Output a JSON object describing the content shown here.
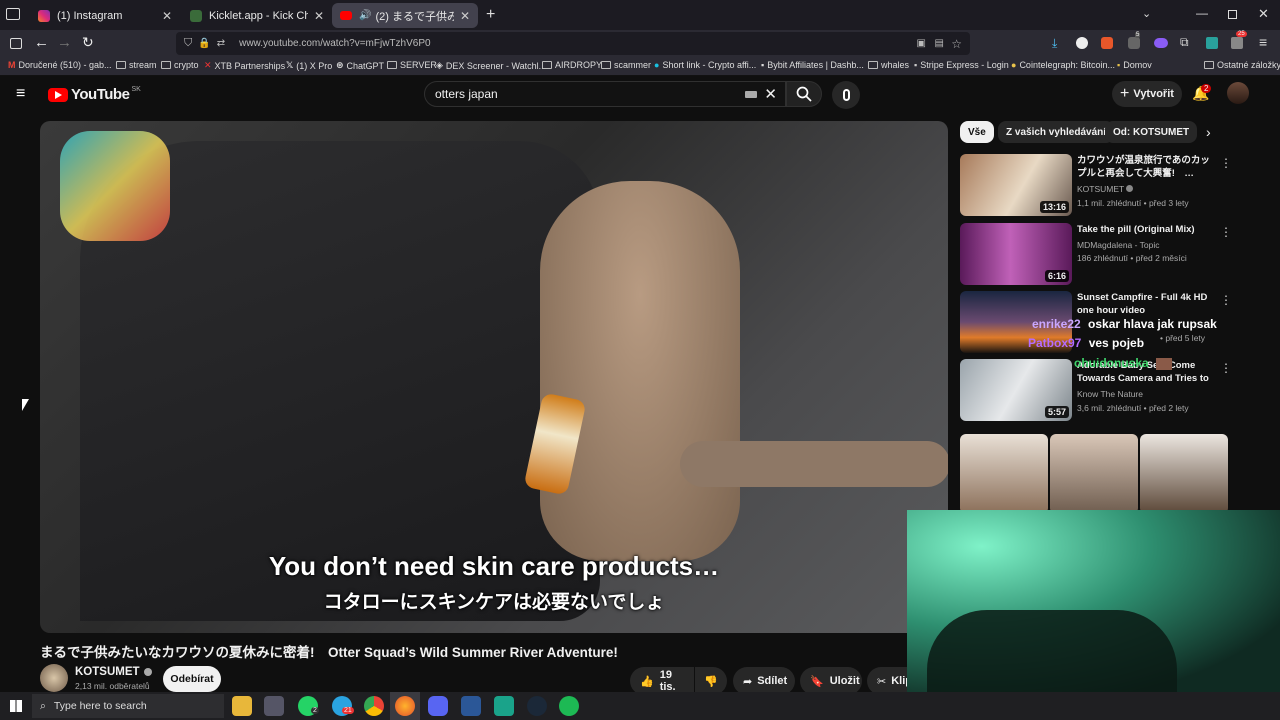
{
  "browser": {
    "tabs": [
      {
        "title": "(1) Instagram",
        "active": false
      },
      {
        "title": "Kicklet.app - Kick Chatbot and C",
        "active": false
      },
      {
        "title": "(2) まるで子供みたいなカ",
        "active": true
      }
    ],
    "url": "www.youtube.com/watch?v=mFjwTzhV6P0",
    "bookmarks": [
      "Doručené (510) - gab...",
      "stream",
      "crypto",
      "XTB Partnerships",
      "(1) X Pro",
      "ChatGPT",
      "SERVER",
      "DEX Screener - Watchl...",
      "AIRDROPY",
      "scammer",
      "Short link - Crypto affi...",
      "Bybit Affiliates | Dashb...",
      "whales",
      "Stripe Express - Login",
      "Cointelegraph: Bitcoin...",
      "Domov",
      "Ostatné záložky"
    ],
    "notif_count": "25",
    "ext_badge": "5"
  },
  "youtube": {
    "logo": "YouTube",
    "region": "SK",
    "search_query": "otters japan",
    "create_label": "Vytvořit",
    "bell_count": "2",
    "chips": [
      "Vše",
      "Z vašich vyhledávání",
      "Od: KOTSUMET"
    ],
    "subtitle_en": "You don’t need skin care products…",
    "subtitle_jp": "コタローにスキンケアは必要ないでしょ",
    "video_title": "まるで子供みたいなカワウソの夏休みに密着!　Otter Squad’s Wild Summer River Adventure!",
    "channel": "KOTSUMET",
    "subscribers": "2,13 mil. odběratelů",
    "subscribe_label": "Odebírat",
    "likes": "19 tis.",
    "share_label": "Sdílet",
    "save_label": "Uložit",
    "clip_label": "Klip",
    "recommendations": [
      {
        "title": "カワウソが温泉旅行であのカップルと再会して大興奮!　…",
        "channel": "KOTSUMET",
        "meta": "1,1 mil. zhlédnutí • před 3 lety",
        "duration": "13:16"
      },
      {
        "title": "Take the pill (Original Mix)",
        "channel": "MDMagdalena - Topic",
        "meta": "186 zhlédnutí • před 2 měsíci",
        "duration": "6:16"
      },
      {
        "title": "Sunset Campfire - Full 4k HD one hour video",
        "channel": "",
        "meta": "• před 5 lety",
        "duration": ""
      },
      {
        "title": "Adorable Baby Seal Come Towards Camera and Tries to ...",
        "channel": "Know The Nature",
        "meta": "3,6 mil. zhlédnutí • před 2 lety",
        "duration": "5:57"
      }
    ]
  },
  "chat_overlay": [
    {
      "user": "enrike22",
      "message": "oskar hlava jak rupsak",
      "color": "#c9a7ff"
    },
    {
      "user": "Patbox97",
      "message": "ves pojeb",
      "color": "#b56cff"
    },
    {
      "user": "ohuidonuska",
      "message": "",
      "color": "#3fd56b"
    }
  ],
  "taskbar": {
    "search_placeholder": "Type here to search",
    "whatsapp_badge": "2",
    "telegram_badge": "21"
  }
}
